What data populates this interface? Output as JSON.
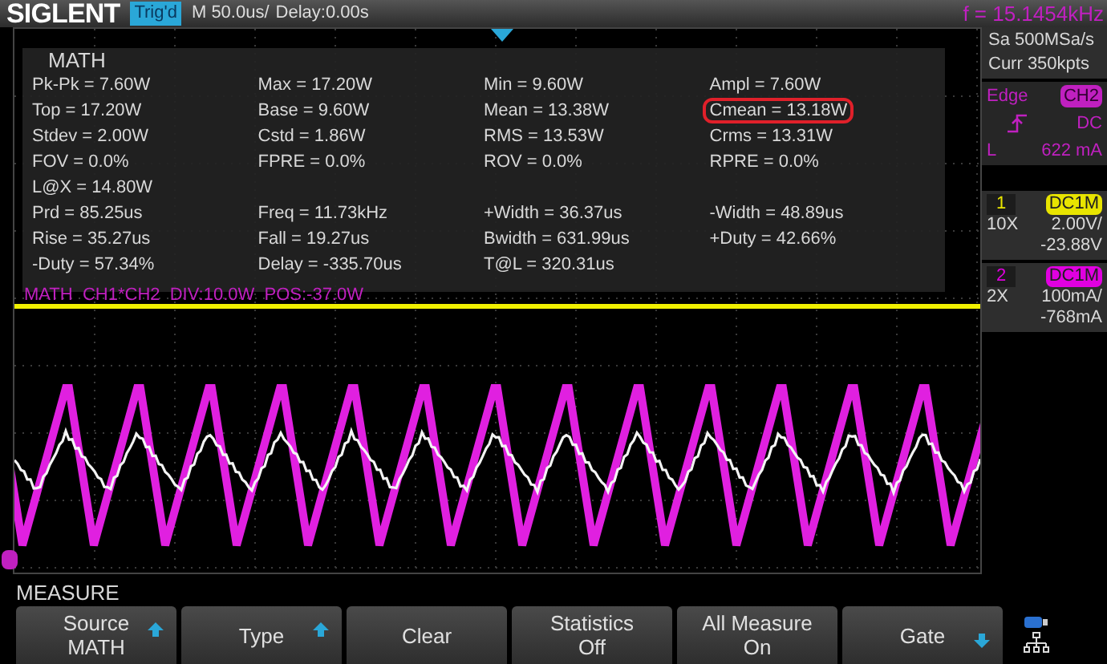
{
  "top_bar": {
    "logo": "SIGLENT",
    "trigger_status": "Trig'd",
    "timebase": "M 50.0us/",
    "delay": "Delay:0.00s",
    "frequency": "f = 15.1454kHz"
  },
  "measure_panel": {
    "source": "MATH",
    "rows": [
      [
        {
          "text": "Pk-Pk = 7.60W",
          "circled": false
        },
        {
          "text": "Max = 17.20W",
          "circled": false
        },
        {
          "text": "Min = 9.60W",
          "circled": false
        },
        {
          "text": "Ampl = 7.60W",
          "circled": false
        }
      ],
      [
        {
          "text": "Top = 17.20W",
          "circled": false
        },
        {
          "text": "Base = 9.60W",
          "circled": false
        },
        {
          "text": "Mean = 13.38W",
          "circled": false
        },
        {
          "text": "Cmean = 13.18W",
          "circled": true
        }
      ],
      [
        {
          "text": "Stdev = 2.00W",
          "circled": false
        },
        {
          "text": "Cstd = 1.86W",
          "circled": false
        },
        {
          "text": "RMS = 13.53W",
          "circled": false
        },
        {
          "text": "Crms = 13.31W",
          "circled": false
        }
      ],
      [
        {
          "text": "FOV = 0.0%",
          "circled": false
        },
        {
          "text": "FPRE = 0.0%",
          "circled": false
        },
        {
          "text": "ROV = 0.0%",
          "circled": false
        },
        {
          "text": "RPRE = 0.0%",
          "circled": false
        }
      ],
      [
        {
          "text": "L@X = 14.80W",
          "circled": false
        }
      ],
      [
        {
          "text": "Prd = 85.25us",
          "circled": false
        },
        {
          "text": "Freq = 11.73kHz",
          "circled": false
        },
        {
          "text": "+Width = 36.37us",
          "circled": false
        },
        {
          "text": "-Width = 48.89us",
          "circled": false
        }
      ],
      [
        {
          "text": "Rise = 35.27us",
          "circled": false
        },
        {
          "text": "Fall = 19.27us",
          "circled": false
        },
        {
          "text": "Bwidth = 631.99us",
          "circled": false
        },
        {
          "text": "+Duty = 42.66%",
          "circled": false
        }
      ],
      [
        {
          "text": "-Duty = 57.34%",
          "circled": false
        },
        {
          "text": "Delay = -335.70us",
          "circled": false
        },
        {
          "text": "T@L = 320.31us",
          "circled": false
        }
      ]
    ]
  },
  "math_label": "MATH  CH1*CH2  DIV:10.0W  POS:-37.0W",
  "acquisition": {
    "sample_rate": "Sa 500MSa/s",
    "memory": "Curr 350kpts"
  },
  "trigger": {
    "type": "Edge",
    "source": "CH2",
    "coupling": "DC",
    "level_label": "L",
    "level_value": "622 mA"
  },
  "channels": [
    {
      "number": "1",
      "coupling": "DC1M",
      "probe": "10X",
      "scale": "2.00V/",
      "offset": "-23.88V",
      "color": "#e8e400"
    },
    {
      "number": "2",
      "coupling": "DC1M",
      "probe": "2X",
      "scale": "100mA/",
      "offset": "-768mA",
      "color": "#e000e0"
    }
  ],
  "menu": {
    "title": "MEASURE",
    "buttons": [
      {
        "lines": [
          "Source",
          "MATH"
        ],
        "arrow_up": true,
        "arrow_down": false
      },
      {
        "lines": [
          "Type"
        ],
        "arrow_up": true,
        "arrow_down": false
      },
      {
        "lines": [
          "Clear"
        ],
        "arrow_up": false,
        "arrow_down": false
      },
      {
        "lines": [
          "Statistics",
          "Off"
        ],
        "arrow_up": false,
        "arrow_down": false
      },
      {
        "lines": [
          "All Measure",
          "On"
        ],
        "arrow_up": false,
        "arrow_down": false
      },
      {
        "lines": [
          "Gate"
        ],
        "arrow_up": false,
        "arrow_down": true
      }
    ]
  }
}
